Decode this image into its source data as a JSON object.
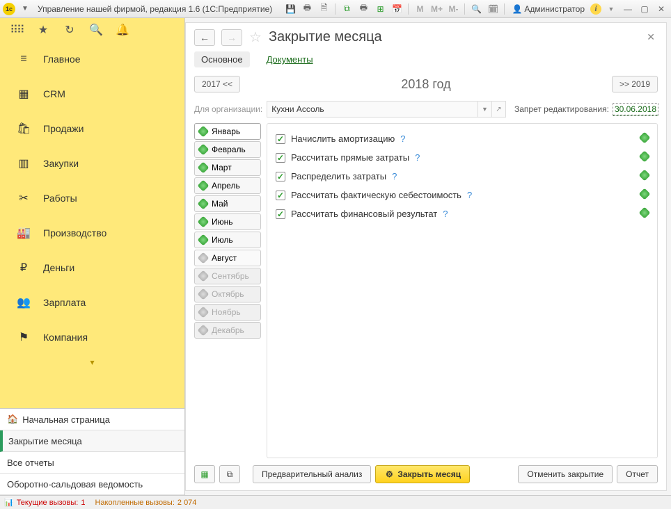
{
  "titlebar": {
    "title": "Управление нашей фирмой, редакция 1.6  (1С:Предприятие)",
    "user": "Администратор",
    "m": "M",
    "mp": "M+",
    "mm": "M-"
  },
  "sidebar": {
    "items": [
      {
        "icon": "≡",
        "label": "Главное"
      },
      {
        "icon": "⊞",
        "label": "CRM"
      },
      {
        "icon": "🛒",
        "label": "Продажи"
      },
      {
        "icon": "📦",
        "label": "Закупки"
      },
      {
        "icon": "✕",
        "label": "Работы"
      },
      {
        "icon": "🏭",
        "label": "Производство"
      },
      {
        "icon": "₽",
        "label": "Деньги"
      },
      {
        "icon": "👥",
        "label": "Зарплата"
      },
      {
        "icon": "⚑",
        "label": "Компания"
      }
    ],
    "tabs": {
      "home": "Начальная страница",
      "t1": "Закрытие месяца",
      "t2": "Все отчеты",
      "t3": "Оборотно-сальдовая ведомость"
    }
  },
  "main": {
    "title": "Закрытие месяца",
    "tabs": {
      "main": "Основное",
      "docs": "Документы"
    },
    "year": {
      "prev": "2017 <<",
      "current": "2018  год",
      "next": ">> 2019"
    },
    "org": {
      "label": "Для организации:",
      "value": "Кухни Ассоль",
      "lock_label": "Запрет редактирования:",
      "lock_date": "30.06.2018"
    },
    "months": [
      {
        "label": "Январь",
        "status": "done",
        "sel": true
      },
      {
        "label": "Февраль",
        "status": "done"
      },
      {
        "label": "Март",
        "status": "done"
      },
      {
        "label": "Апрель",
        "status": "done"
      },
      {
        "label": "Май",
        "status": "done"
      },
      {
        "label": "Июнь",
        "status": "done"
      },
      {
        "label": "Июль",
        "status": "done"
      },
      {
        "label": "Август",
        "status": "cur"
      },
      {
        "label": "Сентябрь",
        "status": "fut"
      },
      {
        "label": "Октябрь",
        "status": "fut"
      },
      {
        "label": "Ноябрь",
        "status": "fut"
      },
      {
        "label": "Декабрь",
        "status": "fut"
      }
    ],
    "ops": [
      {
        "label": "Начислить амортизацию"
      },
      {
        "label": "Рассчитать прямые затраты"
      },
      {
        "label": "Распределить затраты"
      },
      {
        "label": "Рассчитать фактическую себестоимость"
      },
      {
        "label": "Рассчитать финансовый результат"
      }
    ],
    "footer": {
      "preview": "Предварительный анализ",
      "close_month": "Закрыть месяц",
      "cancel": "Отменить закрытие",
      "report": "Отчет"
    }
  },
  "statusbar": {
    "cur_label": "Текущие вызовы:",
    "cur_val": "1",
    "acc_label": "Накопленные вызовы:",
    "acc_val": "2 074"
  }
}
